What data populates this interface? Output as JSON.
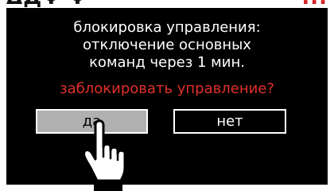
{
  "header_crop": {
    "left_text": "ΔДΨ Ψ",
    "right_text": "...",
    "accent_color": "#d62222"
  },
  "dialog": {
    "message_lines": [
      "блокировка управления:",
      "отключение основных",
      "команд через 1 мин."
    ],
    "question": "заблокировать управление?",
    "question_color": "#e0302a",
    "yes_label": "да",
    "no_label": "нет",
    "background_color": "#000000",
    "selected_button": "yes"
  },
  "icons": {
    "pointer": "pointing-hand-icon"
  }
}
